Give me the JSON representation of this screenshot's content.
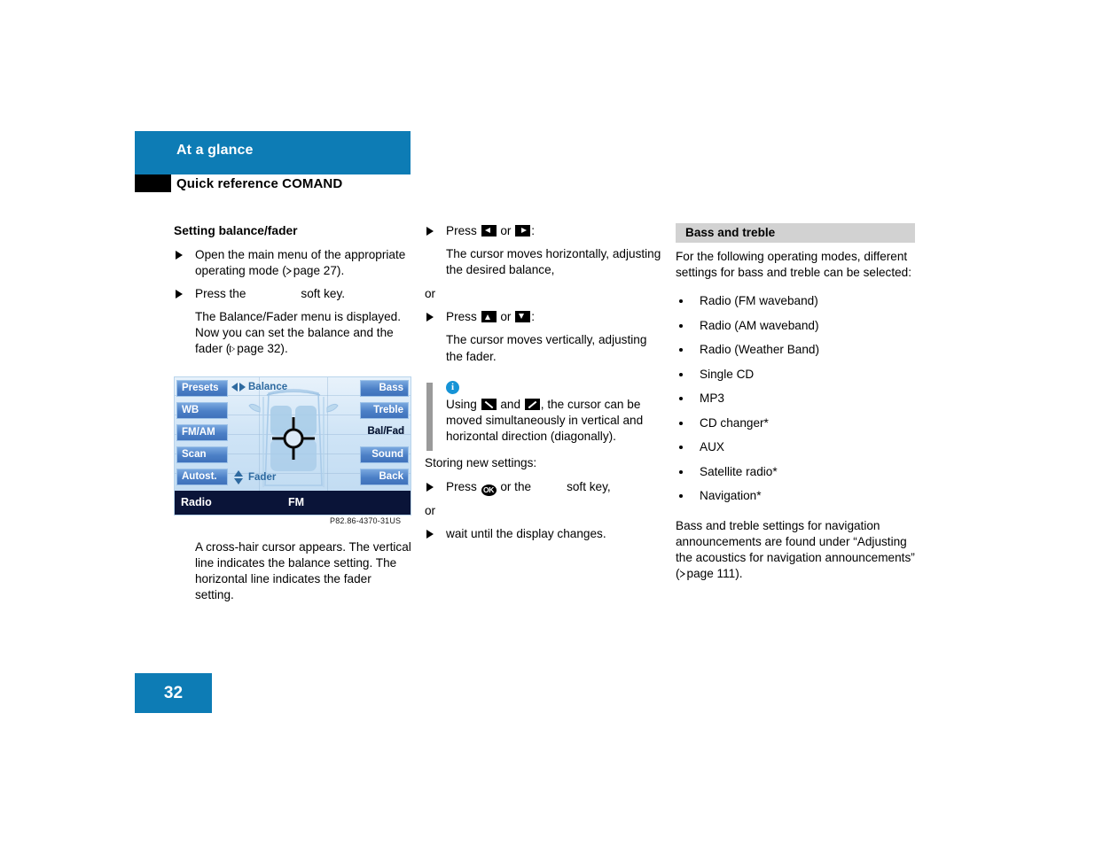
{
  "header": {
    "chapter_title": "At a glance",
    "section_title": "Quick reference COMAND",
    "accent_color": "#0d7cb5"
  },
  "col1": {
    "heading": "Setting balance/fader",
    "step1_a": "Open the main menu of the appropriate operating mode (",
    "step1_page": "page 27).",
    "step2_a": "Press the",
    "step2_b": "soft key.",
    "result_a": "The Balance/Fader menu is displayed. Now you can set the balance and the fader (",
    "result_page": "page 32)."
  },
  "comand": {
    "left_keys": [
      "Presets",
      "WB",
      "FM/AM",
      "Scan",
      "Autost."
    ],
    "right_keys": [
      "Bass",
      "Treble",
      "Bal/Fad",
      "Sound",
      "Back"
    ],
    "active_right_key": "Bal/Fad",
    "balance_label": "Balance",
    "fader_label": "Fader",
    "status_left": "Radio",
    "status_mid": "FM",
    "caption": "P82.86-4370-31US"
  },
  "img_note": "A cross-hair cursor appears. The vertical line indicates the balance setting. The horizontal line indicates the fader setting.",
  "col2": {
    "press_a": "Press",
    "or_inline": "or",
    "colon": ":",
    "result1": "The cursor moves horizontally, adjusting the desired balance,",
    "or_word": "or",
    "result2": "The cursor moves vertically, adjusting the fader.",
    "note_a": "Using",
    "note_and": "and",
    "note_b": ", the cursor can be moved simultaneously in vertical and horizontal direction (diagonally).",
    "storing": "Storing new settings:",
    "press_ok_a": "Press",
    "press_ok_b": "or the",
    "press_ok_c": "soft key,",
    "wait": "wait until the display changes."
  },
  "col3": {
    "heading": "Bass and treble",
    "intro": "For the following operating modes, different settings for bass and treble can be selected:",
    "bullets": [
      "Radio (FM waveband)",
      "Radio (AM waveband)",
      "Radio (Weather Band)",
      "Single CD",
      "MP3",
      "CD changer*",
      "AUX",
      "Satellite radio*",
      "Navigation*"
    ],
    "tail_a": "Bass and treble settings for navigation announcements are found under “Adjusting the acoustics for navigation announcements” (",
    "tail_page": "page 111)."
  },
  "footer": {
    "page_number": "32"
  }
}
